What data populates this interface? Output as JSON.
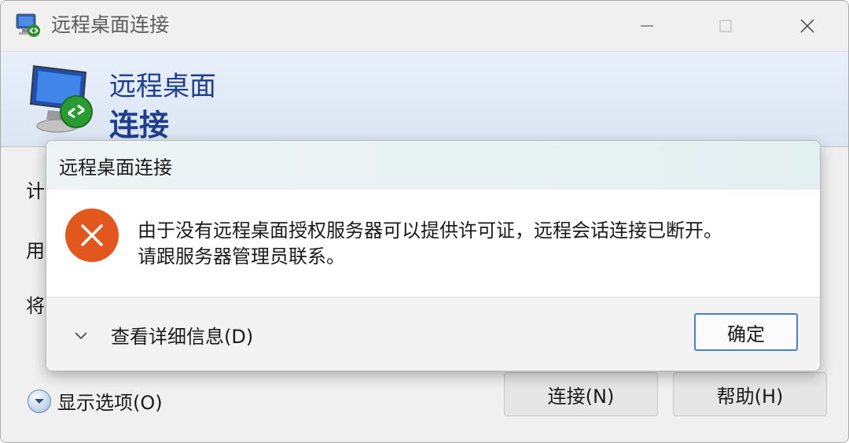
{
  "window": {
    "title": "远程桌面连接",
    "controls": {
      "minimize": "—",
      "maximize": "☐",
      "close": "✕"
    }
  },
  "banner": {
    "line1": "远程桌面",
    "line2": "连接"
  },
  "form": {
    "labels": [
      "计",
      "用",
      "将"
    ]
  },
  "options_toggle": {
    "label": "显示选项(O)"
  },
  "buttons": {
    "connect": "连接(N)",
    "help": "帮助(H)"
  },
  "dialog": {
    "title": "远程桌面连接",
    "message_line1": "由于没有远程桌面授权服务器可以提供许可证，远程会话连接已断开。",
    "message_line2": "请跟服务器管理员联系。",
    "details_label": "查看详细信息(D)",
    "ok_label": "确定",
    "icon": "error-icon"
  },
  "colors": {
    "banner_text": "#1f3f8c",
    "error": "#e2571e",
    "accent_border": "#4a7fc9"
  }
}
